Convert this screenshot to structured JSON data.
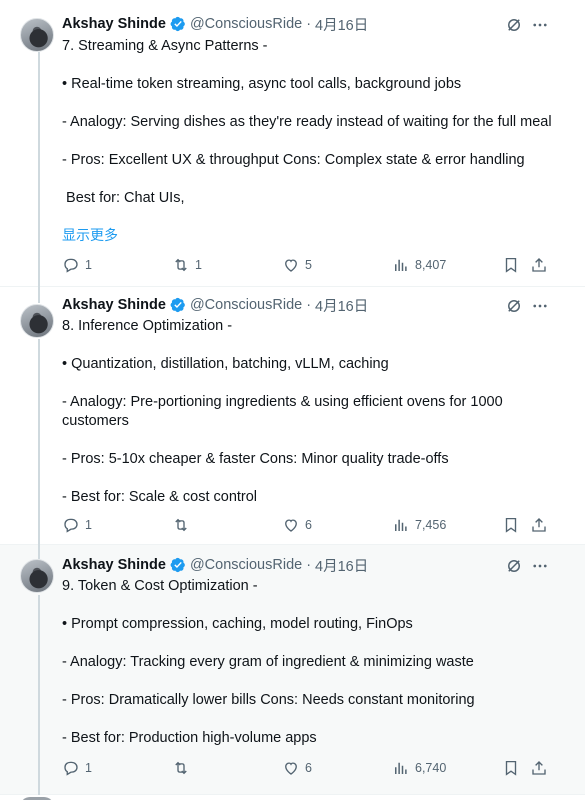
{
  "tweets": [
    {
      "name": "Akshay Shinde",
      "handle": "@ConsciousRide",
      "sep": "·",
      "date": "4月16日",
      "lines": [
        "7. Streaming & Async Patterns -",
        "",
        "• Real-time token streaming, async tool calls, background jobs",
        "",
        "- Analogy: Serving dishes as they're ready instead of waiting for the full meal",
        "",
        "- Pros: Excellent UX & throughput Cons: Complex state & error handling",
        "",
        " Best for: Chat UIs,"
      ],
      "show_more": "显示更多",
      "replies": "1",
      "reposts": "1",
      "likes": "5",
      "views": "8,407"
    },
    {
      "name": "Akshay Shinde",
      "handle": "@ConsciousRide",
      "sep": "·",
      "date": "4月16日",
      "lines": [
        "8. Inference Optimization -",
        "",
        "• Quantization, distillation, batching, vLLM, caching",
        "",
        "- Analogy: Pre-portioning ingredients & using efficient ovens for 1000 customers",
        "",
        "- Pros: 5-10x cheaper & faster Cons: Minor quality trade-offs",
        "",
        "- Best for: Scale & cost control"
      ],
      "replies": "1",
      "reposts": "",
      "likes": "6",
      "views": "7,456"
    },
    {
      "name": "Akshay Shinde",
      "handle": "@ConsciousRide",
      "sep": "·",
      "date": "4月16日",
      "lines": [
        "9. Token & Cost Optimization -",
        "",
        "• Prompt compression, caching, model routing, FinOps",
        "",
        "- Analogy: Tracking every gram of ingredient & minimizing waste",
        "",
        "- Pros: Dramatically lower bills Cons: Needs constant monitoring",
        "",
        "- Best for: Production high-volume apps"
      ],
      "replies": "1",
      "reposts": "",
      "likes": "6",
      "views": "6,740"
    }
  ],
  "icons": {
    "verified": "verified-badge-icon",
    "grok": "grok-icon",
    "more": "more-icon",
    "reply": "reply-icon",
    "repost": "repost-icon",
    "like": "like-icon",
    "views": "views-icon",
    "bookmark": "bookmark-icon",
    "share": "share-icon"
  },
  "colors": {
    "accent": "#1d9bf0",
    "muted": "#536471",
    "text": "#0f1419"
  }
}
